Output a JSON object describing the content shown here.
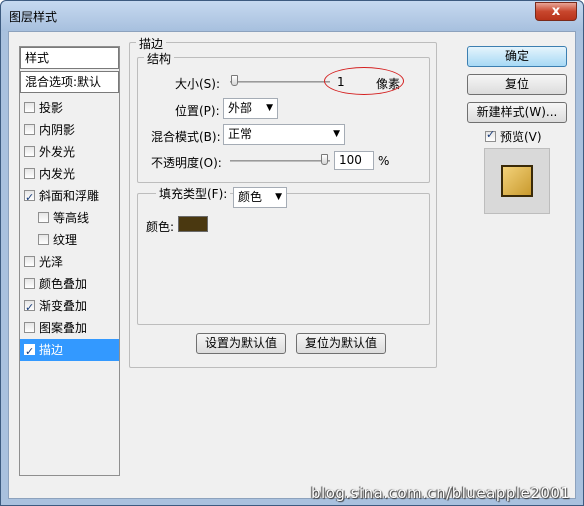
{
  "window": {
    "title": "图层样式",
    "close": "x"
  },
  "left_list": {
    "header": "样式",
    "blend_options": "混合选项:默认",
    "items": [
      {
        "label": "投影",
        "checked": false
      },
      {
        "label": "内阴影",
        "checked": false
      },
      {
        "label": "外发光",
        "checked": false
      },
      {
        "label": "内发光",
        "checked": false
      },
      {
        "label": "斜面和浮雕",
        "checked": true
      },
      {
        "label": "等高线",
        "checked": false
      },
      {
        "label": "纹理",
        "checked": false
      },
      {
        "label": "光泽",
        "checked": false
      },
      {
        "label": "颜色叠加",
        "checked": false
      },
      {
        "label": "渐变叠加",
        "checked": true
      },
      {
        "label": "图案叠加",
        "checked": false
      },
      {
        "label": "描边",
        "checked": true
      }
    ]
  },
  "stroke": {
    "title": "描边",
    "structure": {
      "title": "结构",
      "size_label": "大小(S):",
      "size_value": "1",
      "size_unit": "像素",
      "position_label": "位置(P):",
      "position_value": "外部",
      "blend_label": "混合模式(B):",
      "blend_value": "正常",
      "opacity_label": "不透明度(O):",
      "opacity_value": "100",
      "opacity_unit": "%"
    },
    "fill": {
      "type_label": "填充类型(F):",
      "type_value": "颜色",
      "color_label": "颜色:",
      "color": "#4a3810"
    },
    "set_default": "设置为默认值",
    "reset_default": "复位为默认值"
  },
  "buttons": {
    "ok": "确定",
    "reset": "复位",
    "new_style": "新建样式(W)...",
    "preview_label": "预览(V)",
    "preview_checked": true
  },
  "watermark": "blog.sina.com.cn/blueapple2001"
}
